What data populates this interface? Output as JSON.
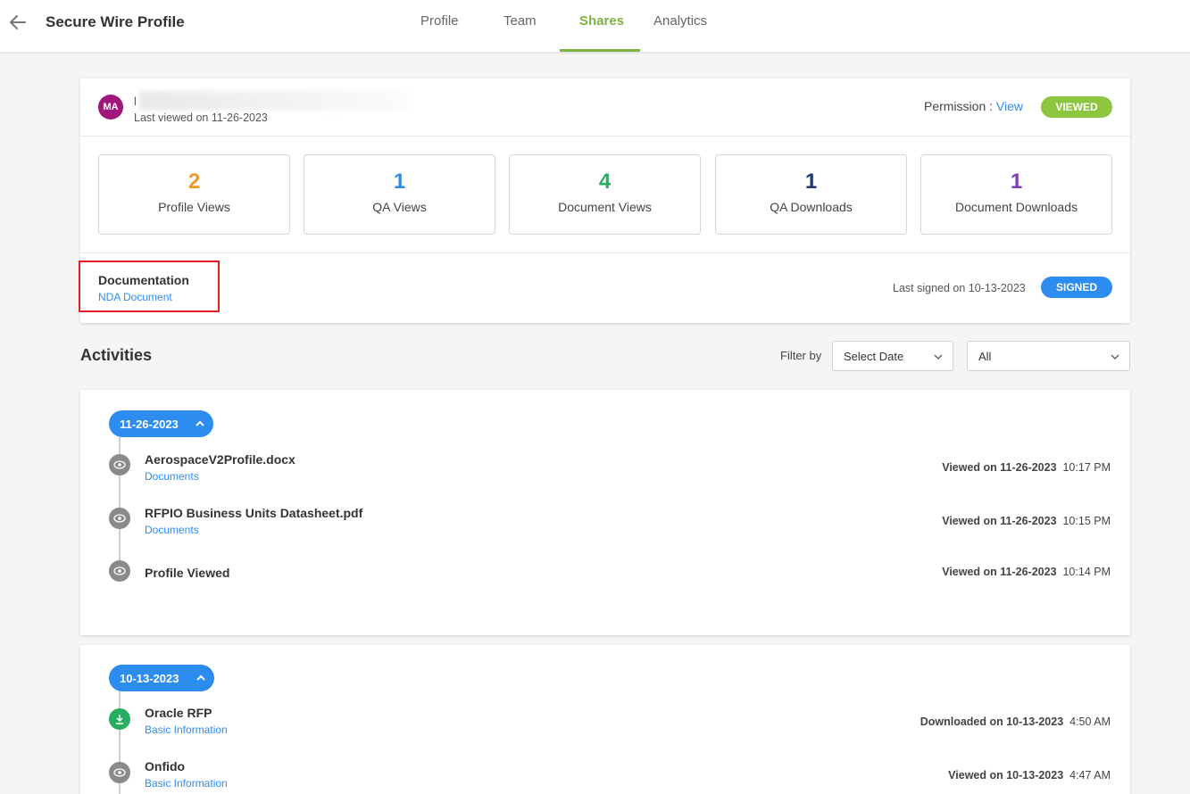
{
  "header": {
    "title": "Secure Wire Profile",
    "tabs": [
      {
        "label": "Profile"
      },
      {
        "label": "Team"
      },
      {
        "label": "Shares"
      },
      {
        "label": "Analytics"
      }
    ],
    "active_tab": "Shares"
  },
  "summary": {
    "avatar_initials": "MA",
    "user_name": "l",
    "last_viewed": "Last viewed on 11-26-2023",
    "permission_label": "Permission :",
    "permission_value": "View",
    "status_badge": "VIEWED",
    "stats": [
      {
        "value": "2",
        "label": "Profile Views",
        "color": "#f0962a"
      },
      {
        "value": "1",
        "label": "QA Views",
        "color": "#2d8cf0"
      },
      {
        "value": "4",
        "label": "Document Views",
        "color": "#27ae60"
      },
      {
        "value": "1",
        "label": "QA Downloads",
        "color": "#1e3a6e"
      },
      {
        "value": "1",
        "label": "Document Downloads",
        "color": "#7b3fb3"
      }
    ],
    "documentation_title": "Documentation",
    "documentation_link": "NDA Document",
    "last_signed": "Last signed on 10-13-2023",
    "signed_badge": "SIGNED"
  },
  "activities": {
    "title": "Activities",
    "filter_label": "Filter by",
    "date_select": "Select Date",
    "type_select": "All",
    "groups": [
      {
        "date": "11-26-2023",
        "items": [
          {
            "title": "AerospaceV2Profile.docx",
            "subtitle": "Documents",
            "action": "Viewed on 11-26-2023",
            "time": "10:17 PM",
            "icon": "eye-icon"
          },
          {
            "title": "RFPIO Business Units Datasheet.pdf",
            "subtitle": "Documents",
            "action": "Viewed on 11-26-2023",
            "time": "10:15 PM",
            "icon": "eye-icon"
          },
          {
            "title": "Profile Viewed",
            "subtitle": "",
            "action": "Viewed on 11-26-2023",
            "time": "10:14 PM",
            "icon": "eye-icon"
          }
        ]
      },
      {
        "date": "10-13-2023",
        "items": [
          {
            "title": "Oracle RFP",
            "subtitle": "Basic Information",
            "action": "Downloaded on 10-13-2023",
            "time": "4:50 AM",
            "icon": "download-icon"
          },
          {
            "title": "Onfido",
            "subtitle": "Basic Information",
            "action": "Viewed on 10-13-2023",
            "time": "4:47 AM",
            "icon": "eye-icon"
          }
        ]
      }
    ]
  },
  "colors": {
    "accent_green": "#7cb342",
    "link_blue": "#2d8cf0",
    "highlight_red": "#e31e24"
  }
}
